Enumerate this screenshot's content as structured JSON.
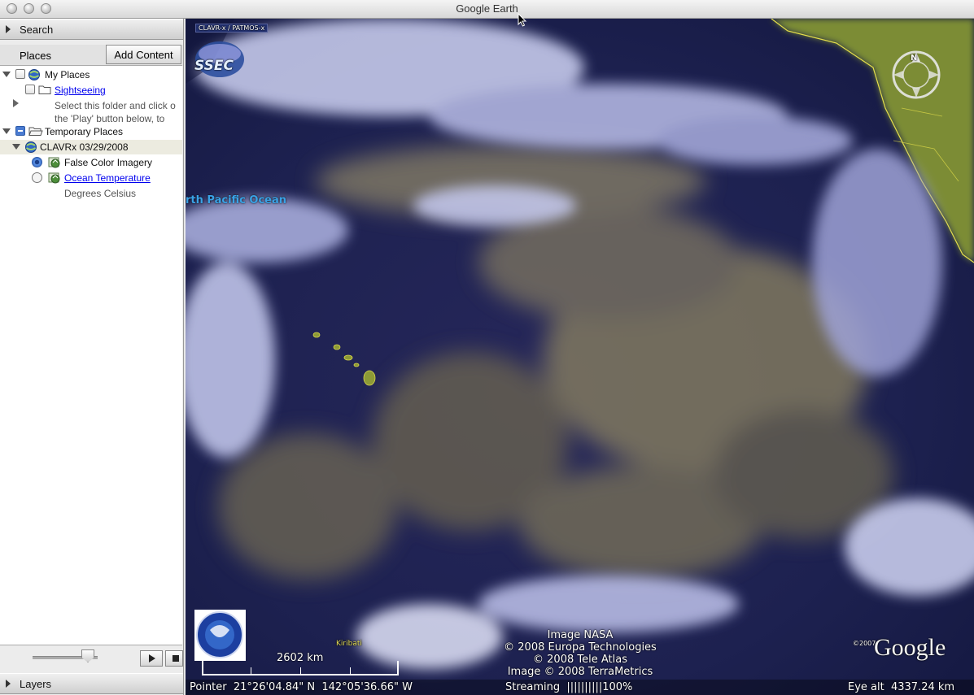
{
  "window": {
    "title": "Google Earth"
  },
  "search": {
    "label": "Search"
  },
  "places": {
    "label": "Places",
    "add_content": "Add Content",
    "tree": [
      {
        "label": "My Places"
      },
      {
        "label": "Sightseeing"
      },
      {
        "desc_line1": "Select this folder and click o",
        "desc_line2": "the 'Play' button below, to"
      },
      {
        "label": "Temporary Places"
      },
      {
        "label": "CLAVRx 03/29/2008"
      },
      {
        "label": "False Color Imagery"
      },
      {
        "label": "Ocean Temperature"
      },
      {
        "label": "Degrees Celsius"
      }
    ]
  },
  "layers": {
    "label": "Layers"
  },
  "map": {
    "top_banner": "CLAVR-x / PATMOS-x",
    "ssec_logo": "SSEC",
    "ocean_label": "rth Pacific Ocean",
    "kiribati_label": "Kiribati",
    "scale_label": "2602 km",
    "credits": [
      "Image NASA",
      "© 2008 Europa Technologies",
      "© 2008 Tele Atlas",
      "Image © 2008 TerraMetrics"
    ],
    "google_year": "©2007",
    "google_logo": "Google",
    "compass_n": "N",
    "noaa_seal": "NOAA NESDIS STAR"
  },
  "status": {
    "pointer": "Pointer  21°26'04.84\" N  142°05'36.66\" W",
    "streaming": "Streaming  ||||||||||100%",
    "eye_alt": "Eye alt  4337.24 km",
    "streaming_percent": 100
  },
  "colors": {
    "ocean": "#1c2256",
    "cloud_white": "#e9ecff",
    "cloud_yellow": "#c9b070",
    "land": "#8a9a3a",
    "link": "#0000ee",
    "selected_row": "#ecebe0"
  }
}
